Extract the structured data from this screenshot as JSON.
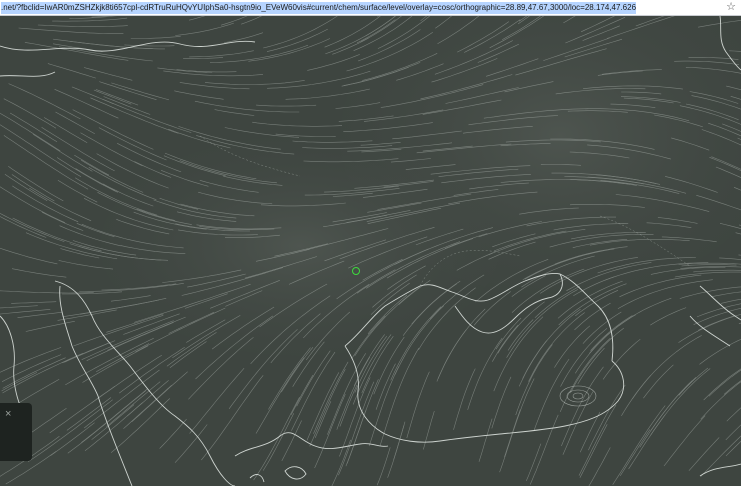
{
  "browser": {
    "url": ".net/?fbclid=IwAR0mZSHZkjk8ti657cpl-cdRTruRuHQvYUIphSa0-hsgtn9io_EVeW60vis#current/chem/surface/level/overlay=cosc/orthographic=28.89,47.67,3000/loc=28.174,47.626",
    "bookmark_icon": "star-icon"
  },
  "map": {
    "background_color": "#3e4540",
    "coastline_color": "#e6ece8",
    "streamline_color": "#dfe6e1"
  },
  "side_panel": {
    "close_glyph": "×"
  },
  "marker": {
    "color": "#3ddc3d"
  }
}
